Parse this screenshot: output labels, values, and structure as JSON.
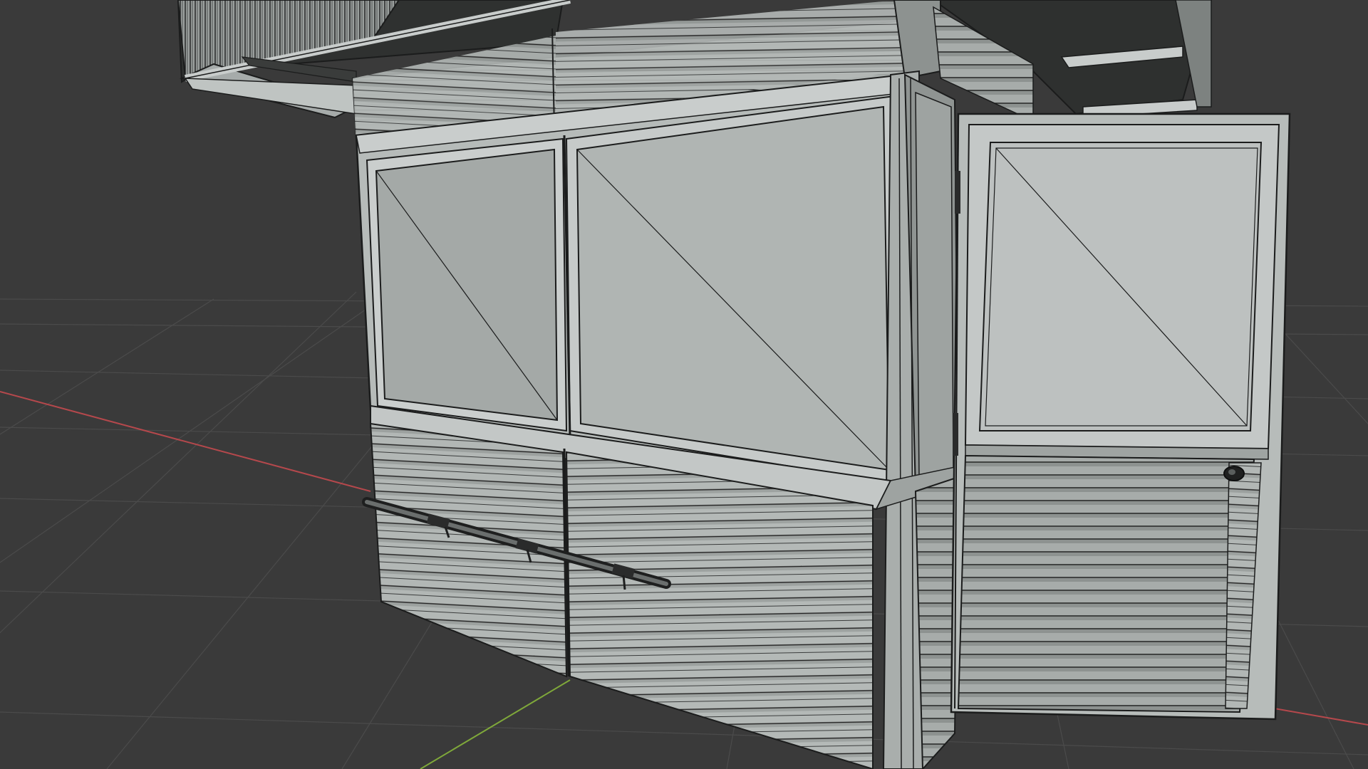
{
  "viewport": {
    "mode": "3D viewport",
    "shading": "solid",
    "overlay": "wireframe",
    "background_color": "#3a3a3a",
    "grid_color": "#4a4a4a",
    "x_axis_color": "#b5484c",
    "y_axis_color": "#7fa83a"
  },
  "model": {
    "name": "kiosk",
    "surface_color": "#b3b8b6",
    "edge_color": "#1e1f1f",
    "parts": [
      "roof-canopy",
      "upper-louvers",
      "front-window-left",
      "front-window-right",
      "lower-louvers",
      "handrail",
      "corner-post",
      "side-door",
      "door-knob"
    ]
  }
}
